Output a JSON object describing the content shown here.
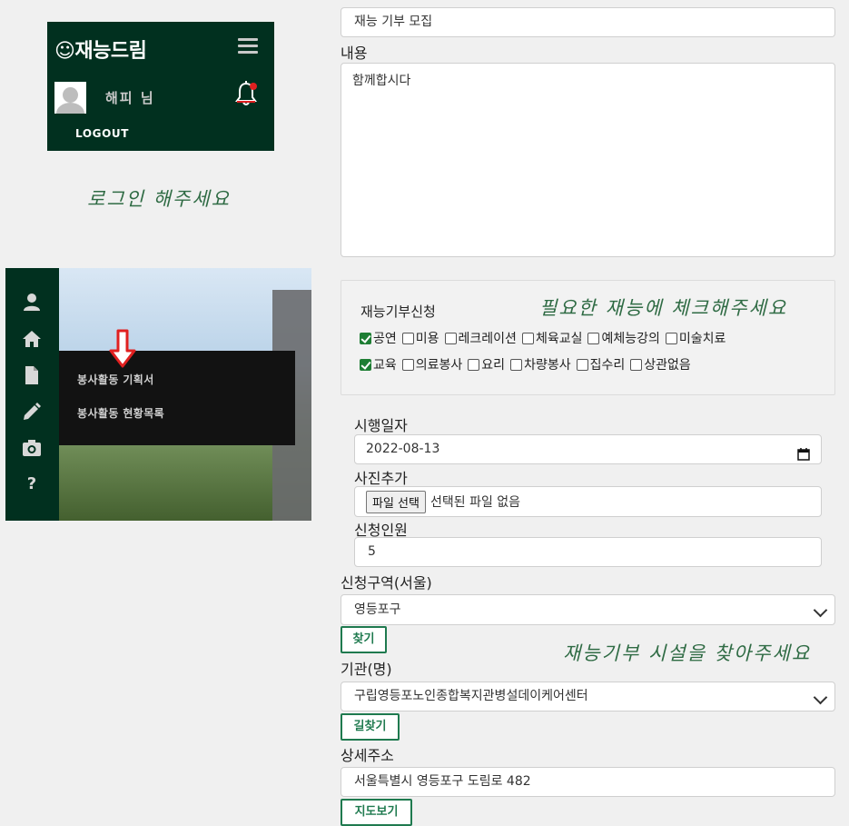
{
  "login_panel": {
    "brand": "☺재능드림",
    "username": "해피 님",
    "logout_label": "LOGOUT"
  },
  "annotations": {
    "login_note": "로그인 해주세요",
    "check_note": "필요한 재능에 체크해주세요",
    "facility_note": "재능기부 시설을 찾아주세요"
  },
  "sidebar_menu": {
    "items": [
      "봉사활동 기획서",
      "봉사활동 현황목록"
    ]
  },
  "form": {
    "title_value": "재능 기부 모집",
    "content_label": "내용",
    "content_value": "함께합시다",
    "talent_label": "재능기부신청",
    "talent_rows": [
      [
        {
          "label": "공연",
          "checked": true
        },
        {
          "label": "미용",
          "checked": false
        },
        {
          "label": "레크레이션",
          "checked": false
        },
        {
          "label": "체육교실",
          "checked": false
        },
        {
          "label": "예체능강의",
          "checked": false
        },
        {
          "label": "미술치료",
          "checked": false
        }
      ],
      [
        {
          "label": "교육",
          "checked": true
        },
        {
          "label": "의료봉사",
          "checked": false
        },
        {
          "label": "요리",
          "checked": false
        },
        {
          "label": "차량봉사",
          "checked": false
        },
        {
          "label": "집수리",
          "checked": false
        },
        {
          "label": "상관없음",
          "checked": false
        }
      ]
    ],
    "date_label": "시행일자",
    "date_value": "2022-08-13",
    "photo_label": "사진추가",
    "file_button": "파일 선택",
    "file_status": "선택된 파일 없음",
    "people_label": "신청인원",
    "people_value": "5",
    "region_label": "신청구역(서울)",
    "region_value": "영등포구",
    "find_button": "찾기",
    "org_label": "기관(명)",
    "org_value": "구립영등포노인종합복지관병설데이케어센터",
    "route_button": "길찾기",
    "addr_label": "상세주소",
    "addr_value": "서울특별시 영등포구 도림로 482",
    "map_button": "지도보기"
  },
  "colors": {
    "panel_bg": "#01301f",
    "accent_green": "#1f7a4f",
    "note_green": "#2f6b44",
    "arrow_red": "#e02020"
  }
}
